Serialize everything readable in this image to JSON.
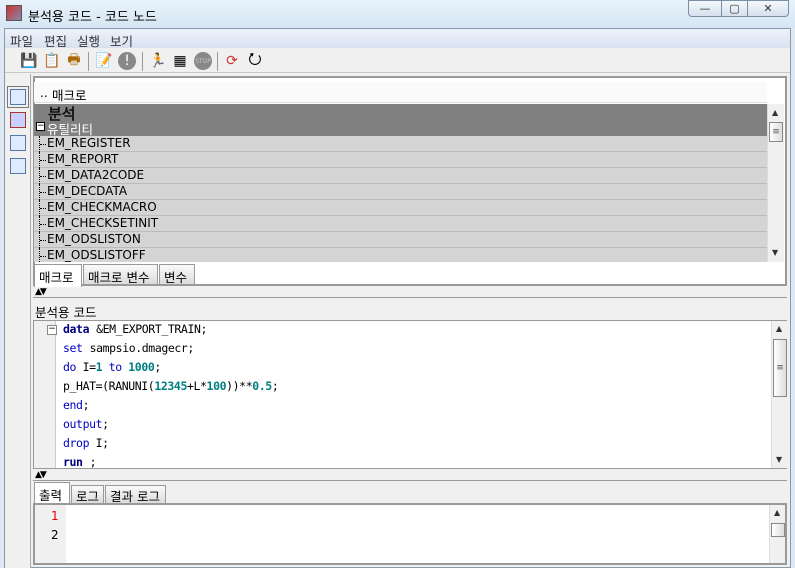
{
  "window": {
    "title": "분석용 코드 - 코드 노드",
    "minimize": "—",
    "maximize": "▢",
    "close": "✕"
  },
  "menu": [
    "파일",
    "편집",
    "실행",
    "보기"
  ],
  "toolbar": [
    "save-icon",
    "copy-icon",
    "print-icon",
    "run-macro-icon",
    "info-icon",
    "run-icon",
    "results-icon",
    "stop-icon",
    "refresh-icon",
    "reset-icon"
  ],
  "macro_panel": {
    "header": "매크로",
    "header_prefix": "..",
    "group": "분석",
    "subgroup": "유틸리티",
    "items": [
      "EM_REGISTER",
      "EM_REPORT",
      "EM_DATA2CODE",
      "EM_DECDATA",
      "EM_CHECKMACRO",
      "EM_CHECKSETINIT",
      "EM_ODSLISTON",
      "EM_ODSLISTOFF"
    ],
    "tabs": [
      "매크로",
      "매크로 변수",
      "변수"
    ]
  },
  "code_panel": {
    "label": "분석용 코드",
    "lines": [
      [
        [
          "kwb",
          "data"
        ],
        [
          "",
          "&EM_EXPORT_TRAIN;"
        ]
      ],
      [
        [
          "kw",
          "set"
        ],
        [
          "",
          "sampsio.dmagecr;"
        ]
      ],
      [
        [
          "kw",
          "do"
        ],
        [
          "",
          " I="
        ],
        [
          "num",
          "1"
        ],
        [
          "kw",
          " to "
        ],
        [
          "num",
          "1000"
        ],
        [
          "",
          ";"
        ]
      ],
      [
        [
          "",
          "p_HAT=(RANUNI("
        ],
        [
          "num",
          "12345"
        ],
        [
          "",
          "+L*"
        ],
        [
          "num",
          "100"
        ],
        [
          "",
          "))**"
        ],
        [
          "num",
          "0.5"
        ],
        [
          "",
          ";"
        ]
      ],
      [
        [
          "kw",
          "end"
        ],
        [
          "",
          ";"
        ]
      ],
      [
        [
          "kw",
          "output"
        ],
        [
          "",
          ";"
        ]
      ],
      [
        [
          "kw",
          "drop"
        ],
        [
          "",
          " I;"
        ]
      ],
      [
        [
          "kwb",
          "run"
        ],
        [
          "",
          ";"
        ]
      ]
    ]
  },
  "output_panel": {
    "tabs": [
      "출력",
      "로그",
      "결과 로그"
    ],
    "line_numbers": [
      "1",
      "2"
    ]
  }
}
